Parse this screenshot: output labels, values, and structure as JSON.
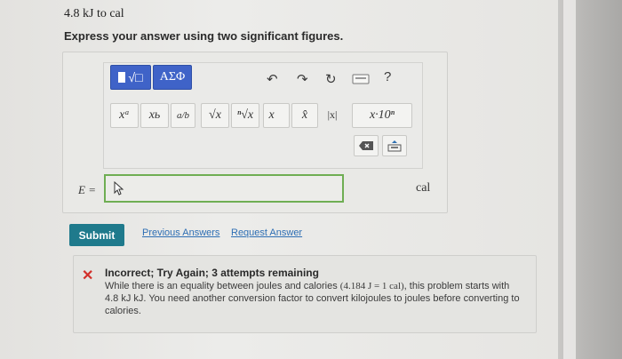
{
  "problem": {
    "text": "4.8 kJ to cal"
  },
  "instructions": "Express your answer using two significant figures.",
  "toolbar": {
    "templates_label": "√□",
    "greek_label": "ΑΣΦ",
    "undo_glyph": "↶",
    "redo_glyph": "↷",
    "reset_glyph": "↻",
    "help_label": "?"
  },
  "math_tools": {
    "superscript": "xᵃ",
    "subscript": "xь",
    "fraction": "a/b",
    "sqrt": "√x",
    "nthroot": "ⁿ√x",
    "vector": "x⃗",
    "unitvec": "x̂",
    "abs": "|x|",
    "sci": "x·10ⁿ"
  },
  "answer": {
    "label": "E =",
    "value": "",
    "unit": "cal"
  },
  "actions": {
    "submit": "Submit",
    "previous_answers": "Previous Answers",
    "request_answer": "Request Answer"
  },
  "feedback": {
    "title": "Incorrect; Try Again; 3 attempts remaining",
    "body_1": "While there is an equality between joules and calories",
    "body_math": "(4.184 J = 1 cal)",
    "body_2": ", this problem starts with 4.8 kJ kJ. You need another conversion factor to convert kilojoules to joules before converting to calories."
  }
}
